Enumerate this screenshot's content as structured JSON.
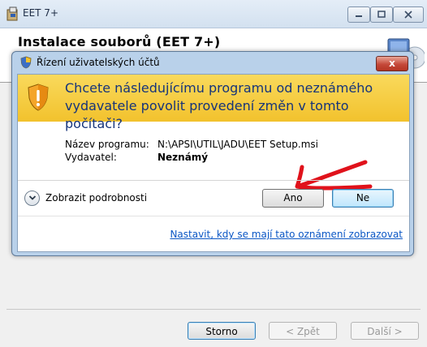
{
  "installer": {
    "window_title": "EET 7+",
    "heading": "Instalace souborů (EET 7+)",
    "buttons": {
      "cancel": "Storno",
      "back": "< Zpět",
      "next": "Další >"
    }
  },
  "uac": {
    "title": "Řízení uživatelských účtů",
    "close_glyph": "x",
    "question": "Chcete následujícímu programu od neznámého vydavatele povolit provedení změn v tomto počítači?",
    "program_label": "Název programu:",
    "program_value": "N:\\APSI\\UTIL\\JADU\\EET Setup.msi",
    "publisher_label": "Vydavatel:",
    "publisher_value": "Neznámý",
    "details_label": "Zobrazit podrobnosti",
    "yes_label": "Ano",
    "no_label": "Ne",
    "settings_link": "Nastavit, kdy se mají tato oznámení zobrazovat"
  },
  "icons": {
    "installer_title_icon": "installer-package-icon",
    "installer_logo": "cd-computer-icon",
    "uac_title_icon": "uac-shield-icon",
    "banner_icon": "warning-shield-icon",
    "details_icon": "chevron-down-icon",
    "annotation": "red-arrow-icon"
  },
  "colors": {
    "banner_yellow": "#f2c22d",
    "question_text": "#16347a",
    "link": "#0b57c5",
    "annotation_red": "#e0121b",
    "close_red": "#c5493a"
  }
}
